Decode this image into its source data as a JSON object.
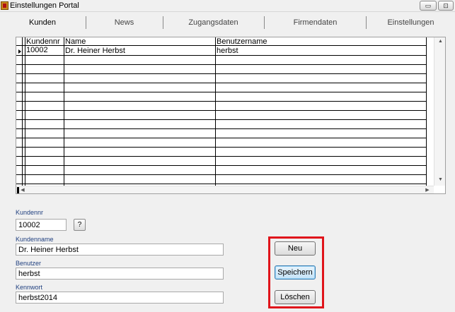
{
  "window": {
    "title": "Einstellungen Portal",
    "min_glyph": "▭",
    "restore_glyph": "⊡"
  },
  "tabs": [
    {
      "label": "Kunden",
      "active": true
    },
    {
      "label": "News",
      "active": false
    },
    {
      "label": "Zugangsdaten",
      "active": false
    },
    {
      "label": "Firmendaten",
      "active": false
    },
    {
      "label": "Einstellungen",
      "active": false
    }
  ],
  "grid": {
    "columns": [
      "Kundennr",
      "Name",
      "Benutzername"
    ],
    "rows": [
      {
        "kundennr": "10002",
        "name": "Dr. Heiner Herbst",
        "benutzername": "herbst"
      }
    ],
    "scroll_up": "▲",
    "scroll_down": "▼",
    "scroll_left": "◀",
    "scroll_right": "▶"
  },
  "form": {
    "kundennr_label": "Kundennr",
    "kundennr_value": "10002",
    "lookup_label": "?",
    "kundenname_label": "Kundenname",
    "kundenname_value": "Dr. Heiner Herbst",
    "benutzer_label": "Benutzer",
    "benutzer_value": "herbst",
    "kennwort_label": "Kennwort",
    "kennwort_value": "herbst2014"
  },
  "actions": {
    "neu_label": "Neu",
    "speichern_label": "Speichern",
    "loeschen_label": "Löschen"
  },
  "colors": {
    "highlight": "#e0141b",
    "label_blue": "#1f3f7f"
  }
}
